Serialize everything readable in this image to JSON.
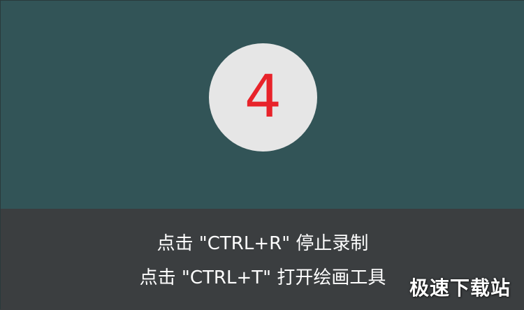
{
  "countdown": {
    "number": "4"
  },
  "hints": {
    "stop_recording": "点击 \"CTRL+R\" 停止录制",
    "open_drawing_tools": "点击 \"CTRL+T\" 打开绘画工具"
  },
  "watermark": {
    "text": "极速下载站"
  },
  "colors": {
    "top_panel": "#325457",
    "bottom_panel": "#3b3e40",
    "circle": "#e6e6e6",
    "countdown_number": "#e8232a",
    "hint_text": "#ffffff"
  }
}
